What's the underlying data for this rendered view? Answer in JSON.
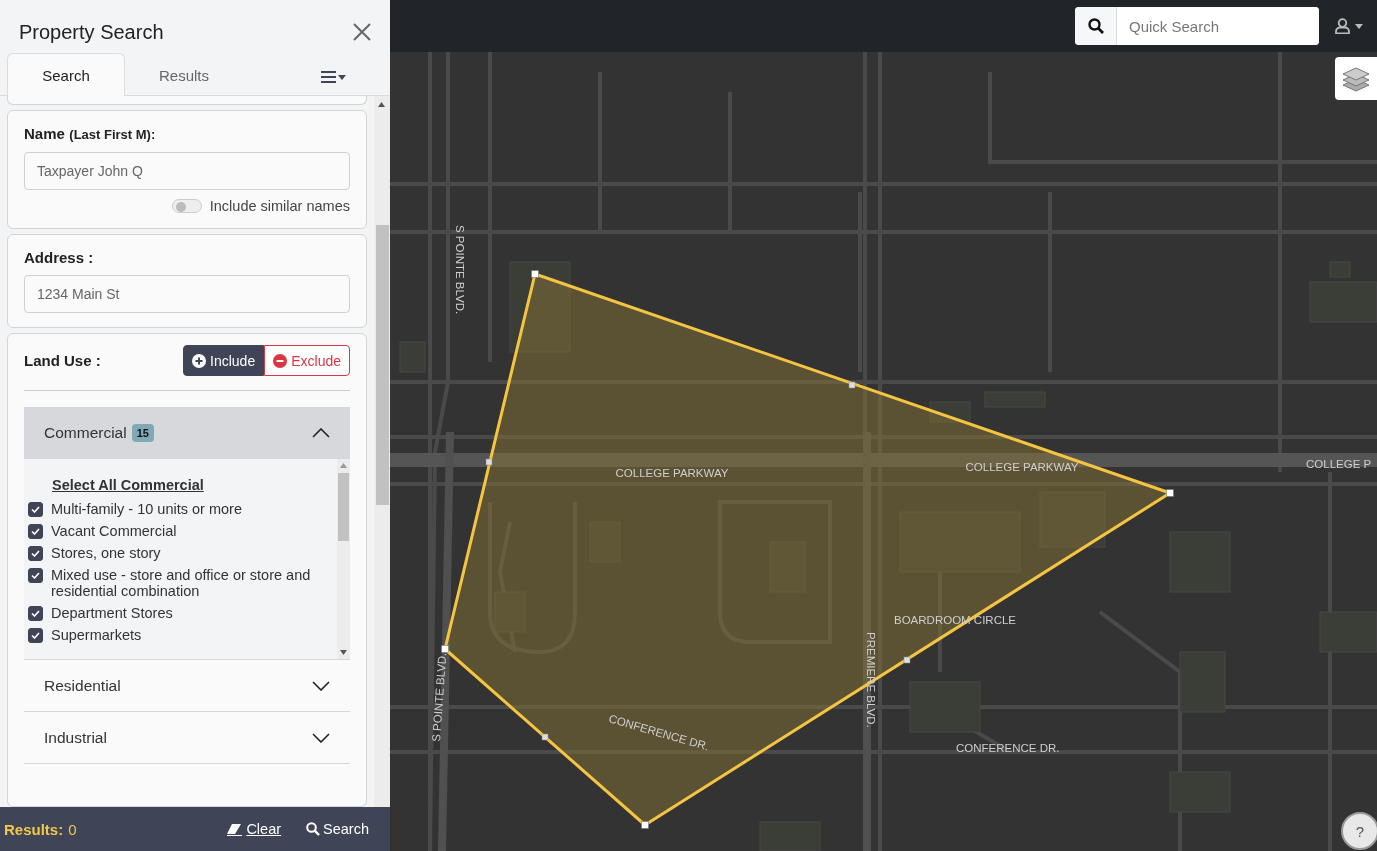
{
  "panel": {
    "title": "Property Search",
    "tabs": [
      {
        "label": "Search",
        "selected": true
      },
      {
        "label": "Results",
        "selected": false
      }
    ],
    "name_section": {
      "label": "Name",
      "hint": "(Last First M):",
      "placeholder": "Taxpayer John Q",
      "toggle": {
        "label": "Include similar names",
        "on": false
      }
    },
    "address_section": {
      "label": "Address :",
      "placeholder": "1234 Main St"
    },
    "land_use": {
      "label": "Land Use :",
      "modes": [
        {
          "kind": "include",
          "label": "Include",
          "selected": true
        },
        {
          "kind": "exclude",
          "label": "Exclude",
          "selected": false
        }
      ],
      "categories": [
        {
          "name": "Commercial",
          "count": "15",
          "expanded": true,
          "select_all": "Select All Commercial",
          "items": [
            {
              "label": "Multi-family - 10 units or more",
              "checked": true
            },
            {
              "label": "Vacant Commercial",
              "checked": true
            },
            {
              "label": "Stores, one story",
              "checked": true
            },
            {
              "label": "Mixed use - store and office or store and residential combination",
              "checked": true
            },
            {
              "label": "Department Stores",
              "checked": true
            },
            {
              "label": "Supermarkets",
              "checked": true
            }
          ]
        },
        {
          "name": "Residential",
          "expanded": false
        },
        {
          "name": "Industrial",
          "expanded": false
        }
      ]
    }
  },
  "footer": {
    "results_label": "Results:",
    "results_count": "0",
    "clear": "Clear",
    "search": "Search"
  },
  "top_bar": {
    "quick_search_placeholder": "Quick Search"
  },
  "map": {
    "street_labels": [
      {
        "text": "S POINTE BLVD."
      },
      {
        "text": "COLLEGE PARKWAY"
      },
      {
        "text": "COLLEGE PARKWAY"
      },
      {
        "text": "COLLEGE P"
      },
      {
        "text": "BOARDROOM CIRCLE"
      },
      {
        "text": "PREMIERE BLVD."
      },
      {
        "text": "S POINTE BLVD."
      },
      {
        "text": "CONFERENCE DR."
      },
      {
        "text": "CONFERENCE DR."
      }
    ],
    "help": "?"
  }
}
